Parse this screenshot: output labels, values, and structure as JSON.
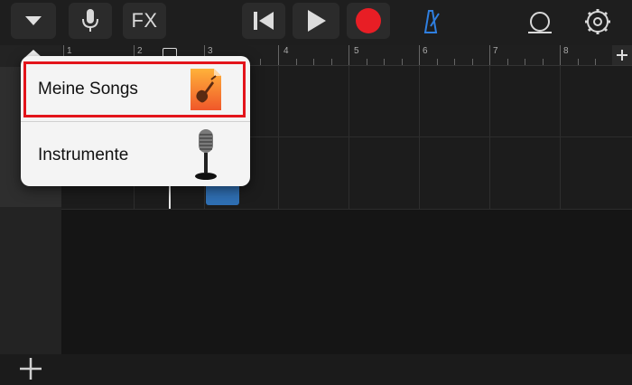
{
  "toolbar": {
    "fx_label": "FX",
    "icons": [
      "chevron-down-icon",
      "microphone-icon",
      "skip-back-icon",
      "play-icon",
      "record-icon",
      "metronome-icon",
      "loop-icon",
      "gear-icon"
    ],
    "colors": {
      "record": "#e81e25",
      "metronome": "#2f7fe0"
    }
  },
  "ruler": {
    "bars": [
      "1",
      "2",
      "3",
      "4",
      "5",
      "6",
      "7",
      "8"
    ],
    "add_icon": "plus-icon"
  },
  "tracks_panel": {
    "add_icon": "plus-icon"
  },
  "popover": {
    "items": [
      {
        "label": "Meine Songs",
        "icon": "garageband-icon",
        "highlighted": true
      },
      {
        "label": "Instrumente",
        "icon": "microphone-icon"
      }
    ],
    "highlight_color": "#e3141b"
  }
}
